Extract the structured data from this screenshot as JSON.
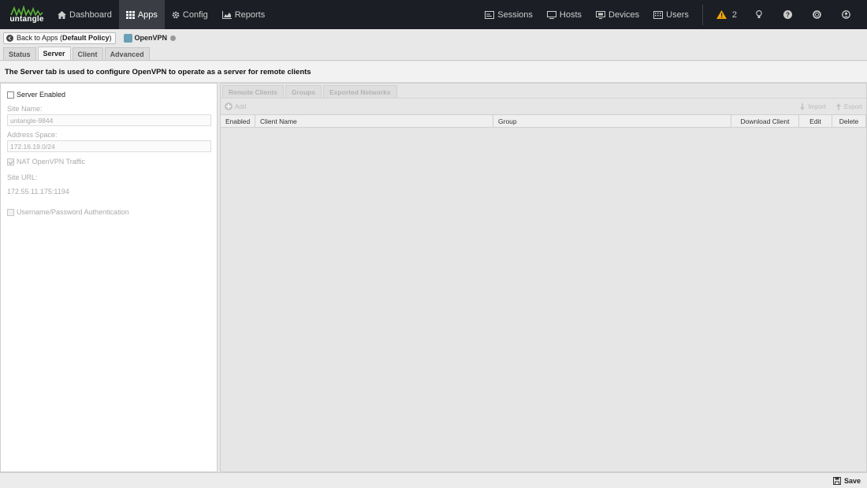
{
  "brand": {
    "logo_text": "untangle",
    "accent": "#5db33a"
  },
  "nav": {
    "left": [
      {
        "label": "Dashboard",
        "icon": "home-icon"
      },
      {
        "label": "Apps",
        "icon": "grid-icon",
        "active": true
      },
      {
        "label": "Config",
        "icon": "gear-icon"
      },
      {
        "label": "Reports",
        "icon": "chart-icon"
      }
    ],
    "right": [
      {
        "label": "Sessions",
        "icon": "sessions-icon"
      },
      {
        "label": "Hosts",
        "icon": "hosts-icon"
      },
      {
        "label": "Devices",
        "icon": "devices-icon"
      },
      {
        "label": "Users",
        "icon": "users-icon"
      }
    ],
    "alert_count": "2",
    "alert_color": "#f0a30a"
  },
  "header": {
    "back_prefix": "Back to Apps (",
    "back_policy": "Default Policy",
    "back_suffix": ")",
    "app_name": "OpenVPN"
  },
  "tabs": [
    "Status",
    "Server",
    "Client",
    "Advanced"
  ],
  "active_tab": "Server",
  "description": "The Server tab is used to configure OpenVPN to operate as a server for remote clients",
  "server": {
    "enabled_label": "Server Enabled",
    "site_name_label": "Site Name:",
    "site_name_value": "untangle-9844",
    "address_space_label": "Address Space:",
    "address_space_value": "172.16.19.0/24",
    "nat_label": "NAT OpenVPN Traffic",
    "site_url_label": "Site URL:",
    "site_url_value": "172.55.11.175:1194",
    "auth_label": "Username/Password Authentication"
  },
  "sub_tabs": [
    "Remote Clients",
    "Groups",
    "Exported Networks"
  ],
  "toolbar": {
    "add": "Add",
    "import": "Import",
    "export": "Export"
  },
  "grid_columns": [
    "Enabled",
    "Client Name",
    "Group",
    "Download Client",
    "Edit",
    "Delete"
  ],
  "footer": {
    "save": "Save"
  }
}
